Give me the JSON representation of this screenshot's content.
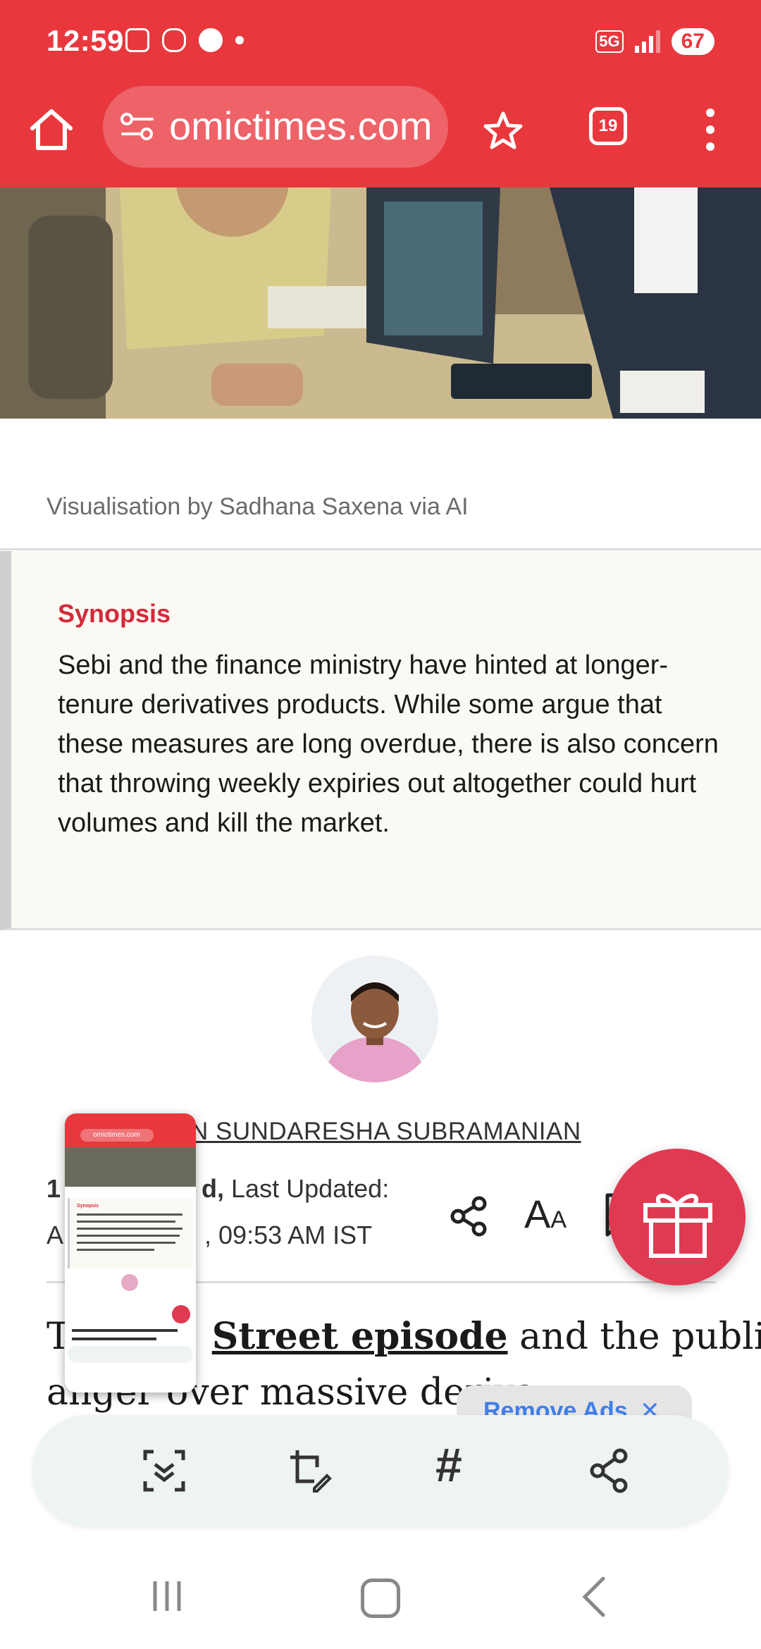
{
  "status_bar": {
    "time": "12:59",
    "network": "5G",
    "battery": "67"
  },
  "browser": {
    "url": "omictimes.com",
    "tab_count": "19"
  },
  "article": {
    "image_caption": "Visualisation by Sadhana Saxena via AI",
    "synopsis_title": "Synopsis",
    "synopsis_text": "Sebi and the finance ministry have hinted at longer-tenure derivatives products. While some argue that these measures are long overdue, there is also concern that throwing weekly expiries out altogether could hurt volumes and kill the market.",
    "author_name": "N SUNDARESHA SUBRAMANIAN",
    "date_line1_prefix": "1",
    "date_line1_bold": "d,",
    "date_line1_rest": " Last Updated:",
    "date_line2_prefix": "A",
    "date_line2_rest": ", 09:53 AM IST",
    "font_tool_big": "A",
    "font_tool_small": "A",
    "body_line1_start": "T",
    "body_line1_link": "Street episode",
    "body_line1_end": " and the public",
    "body_line2": "anger over massive deriva"
  },
  "ads": {
    "remove_ads_label": "Remove Ads"
  },
  "thumbnail": {
    "url": "omictimes.com",
    "synopsis_title": "Synopsis"
  },
  "colors": {
    "brand_red": "#e8383e",
    "synopsis_red": "#d42a3a",
    "gift_fab": "#e03a52",
    "remove_ads_blue": "#3f7fe8"
  },
  "icons": {
    "home": "home-icon",
    "site_settings": "tune-icon",
    "bookmark_star": "star-icon",
    "menu": "more-vert-icon",
    "share": "share-icon",
    "font_size": "font-size-icon",
    "bookmark": "bookmark-icon",
    "gift": "gift-icon",
    "scroll_capture": "scroll-capture-icon",
    "edit_crop": "crop-edit-icon",
    "hashtag": "hashtag-icon",
    "share_screenshot": "share-icon",
    "nav_recents": "recents-icon",
    "nav_home": "nav-home-icon",
    "nav_back": "back-icon"
  }
}
